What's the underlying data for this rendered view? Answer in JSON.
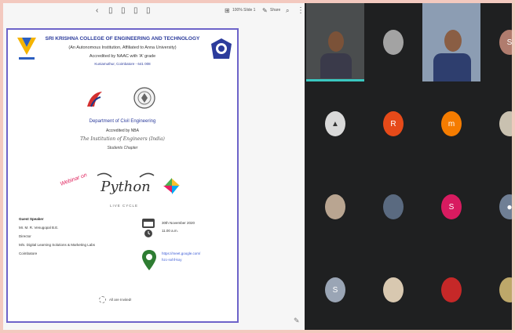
{
  "toolbar": {
    "zoom_label": "100% Slide 1",
    "share_label": "Share"
  },
  "slide": {
    "college_name": "SRI KRISHNA COLLEGE OF ENGINEERING AND TECHNOLOGY",
    "autonomous_line": "(An Autonomous Institution, Affiliated to Anna University)",
    "accreditation": "Accredited by NAAC with 'A' grade",
    "place": "Kuniamuthur, Coimbatore - 641 008",
    "department": "Department of Civil Engineering",
    "nba": "Accredited by NBA",
    "institution": "The Institution of Engineers (India)",
    "chapter": "Students Chapter",
    "webinar_tag": "Webinar on",
    "python_word": "Python",
    "python_sub": "LIVE CYCLE",
    "guest_label": "Guest Speaker",
    "guest_name": "Mr. M. R. Venugopal B.E.",
    "guest_role": "Director",
    "guest_org": "M/s. Digital Learning Solutions & Marketing Labs",
    "guest_city": "Coimbatore",
    "date": "30th November 2020",
    "time": "11.00 a.m.",
    "meet_link_1": "https://meet.google.com/",
    "meet_link_2": "hzc-nxhf-koy",
    "rsvp": "All are Invited!"
  },
  "participants": [
    {
      "type": "video",
      "name": "presenter-1"
    },
    {
      "type": "avatar",
      "initial": "",
      "color": "#a3a3a3"
    },
    {
      "type": "video",
      "name": "presenter-2"
    },
    {
      "type": "avatar",
      "initial": "S",
      "color": "#b07c6e"
    },
    {
      "type": "avatar",
      "initial": "",
      "color": "#d9d9d9"
    },
    {
      "type": "avatar",
      "initial": "R",
      "color": "#e64a19"
    },
    {
      "type": "avatar",
      "initial": "m",
      "color": "#f57c00"
    },
    {
      "type": "avatar",
      "initial": "",
      "color": "#c9c1b0"
    },
    {
      "type": "avatar",
      "initial": "",
      "color": "#b9a591"
    },
    {
      "type": "avatar",
      "initial": "",
      "color": "#5a6a80"
    },
    {
      "type": "avatar",
      "initial": "S",
      "color": "#d81b60"
    },
    {
      "type": "avatar",
      "initial": "",
      "color": "#6f7f95"
    },
    {
      "type": "avatar",
      "initial": "S",
      "color": "#9aa5b5"
    },
    {
      "type": "avatar",
      "initial": "",
      "color": "#d8c8b0"
    },
    {
      "type": "avatar",
      "initial": "",
      "color": "#c62828"
    },
    {
      "type": "avatar",
      "initial": "",
      "color": "#bda86a"
    }
  ]
}
